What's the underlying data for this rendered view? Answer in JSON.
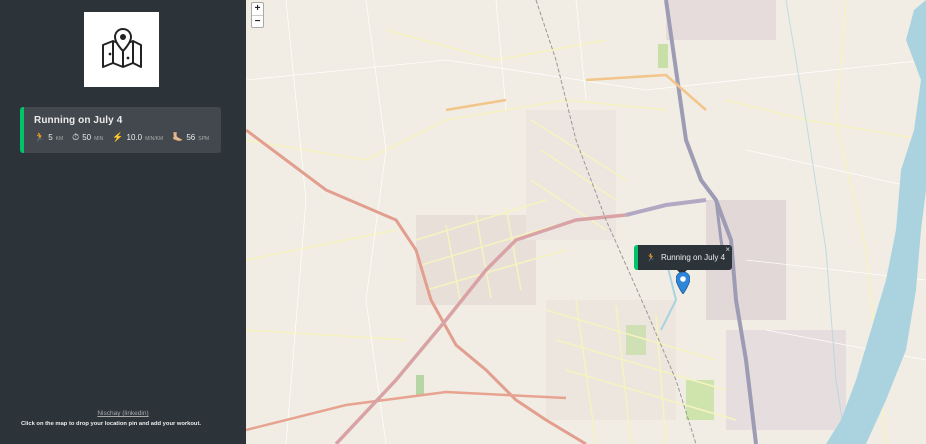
{
  "sidebar": {
    "logo_icon": "map-pin-icon",
    "workouts": [
      {
        "title": "Running on July 4",
        "type": "running",
        "accent": "#00c46a",
        "stats": [
          {
            "icon": "runner-icon",
            "glyph": "🏃",
            "value": "5",
            "unit": "km"
          },
          {
            "icon": "stopwatch-icon",
            "glyph": "⏱",
            "value": "50",
            "unit": "min"
          },
          {
            "icon": "lightning-icon",
            "glyph": "⚡",
            "value": "10.0",
            "unit": "min/km"
          },
          {
            "icon": "footprint-icon",
            "glyph": "🦶🏼",
            "value": "56",
            "unit": "spm"
          }
        ]
      }
    ],
    "footer_link": "Nischay (linkedin)",
    "footer_text": "Click on the map to drop your location pin and add your workout."
  },
  "map": {
    "zoom_in": "+",
    "zoom_out": "−",
    "popup": {
      "icon": "runner-icon",
      "glyph": "🏃",
      "text": "Running on July 4",
      "close": "×"
    },
    "marker_icon": "map-marker-icon",
    "colors": {
      "land": "#f1ede4",
      "water": "#aad3df",
      "major_road": "#e89a8a",
      "railway": "#9a9aa8"
    }
  }
}
